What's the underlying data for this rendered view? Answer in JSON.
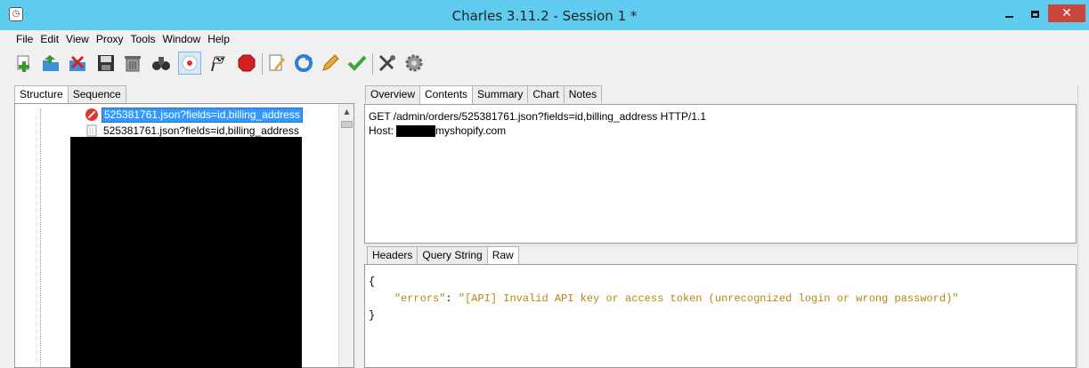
{
  "window": {
    "title": "Charles 3.11.2 - Session 1 *",
    "close_glyph": "✕",
    "app_icon": "charles-pot-icon"
  },
  "menu": [
    "File",
    "Edit",
    "View",
    "Proxy",
    "Tools",
    "Window",
    "Help"
  ],
  "toolbar": {
    "icons": [
      "new-session-icon",
      "open-session-icon",
      "close-session-icon",
      "save-icon",
      "clear-session-icon",
      "find-icon",
      "record-icon",
      "breakpoints-flag-icon",
      "stop-sign-icon",
      "compose-icon",
      "repeat-icon",
      "edit-pencil-icon",
      "validate-check-icon",
      "tools-icon",
      "settings-gear-icon"
    ]
  },
  "left": {
    "tabs": [
      "Structure",
      "Sequence"
    ],
    "active_tab": "Structure",
    "tree": [
      {
        "label": "525381761.json?fields=id,billing_address",
        "selected": true,
        "icon": "blocked-icon"
      },
      {
        "label": "525381761.json?fields=id,billing_address",
        "selected": false,
        "icon": "request-icon"
      }
    ]
  },
  "right": {
    "tabs": [
      "Overview",
      "Contents",
      "Summary",
      "Chart",
      "Notes"
    ],
    "active_tab": "Contents",
    "request_lines": {
      "line1": "GET /admin/orders/525381761.json?fields=id,billing_address HTTP/1.1",
      "host_label": "Host:",
      "host_suffix": "myshopify.com"
    },
    "sub_tabs": [
      "Headers",
      "Query String",
      "Raw"
    ],
    "active_sub_tab": "Raw",
    "raw": {
      "open_brace": "{",
      "key": "\"errors\"",
      "colon": ": ",
      "value": "\"[API] Invalid API key or access token (unrecognized login or wrong password)\"",
      "close_brace": "}"
    }
  },
  "colors": {
    "titlebar": "#5ecbef",
    "close_button": "#c9463d",
    "selection": "#3399ff",
    "json_string": "#b8860b"
  }
}
